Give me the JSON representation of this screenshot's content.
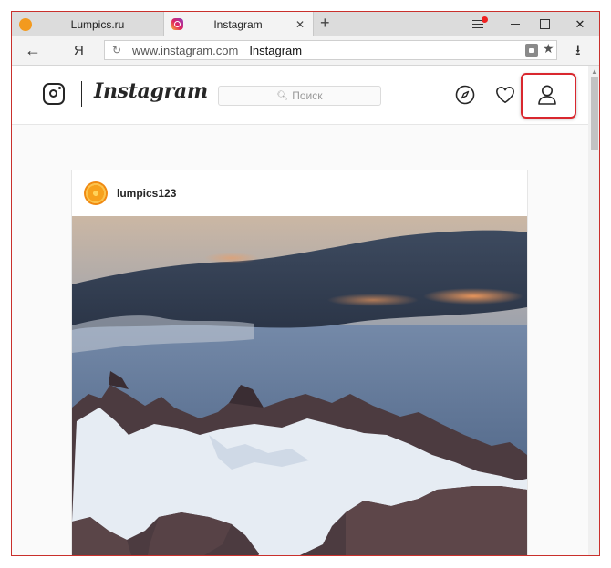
{
  "browser": {
    "tabs": [
      {
        "title": "Lumpics.ru",
        "favicon": "orange-favicon",
        "active": false
      },
      {
        "title": "Instagram",
        "favicon": "instagram-favicon",
        "active": true
      }
    ],
    "new_tab_label": "+",
    "close_label": "✕",
    "back_label": "←",
    "yandex_label": "Я",
    "address": {
      "domain": "www.instagram.com",
      "page_title": "Instagram"
    },
    "accent_color": "#c9302c"
  },
  "instagram": {
    "wordmark": "Instagram",
    "search_placeholder": "Поиск",
    "nav_icons": [
      "compass-icon",
      "heart-icon",
      "profile-icon"
    ]
  },
  "post": {
    "username": "lumpics123",
    "image": "snowy-mountain-under-clouds-photo"
  },
  "colors": {
    "highlight": "#d9272e",
    "instagram_text": "#262626",
    "avatar_orange": "#f7a11c"
  }
}
